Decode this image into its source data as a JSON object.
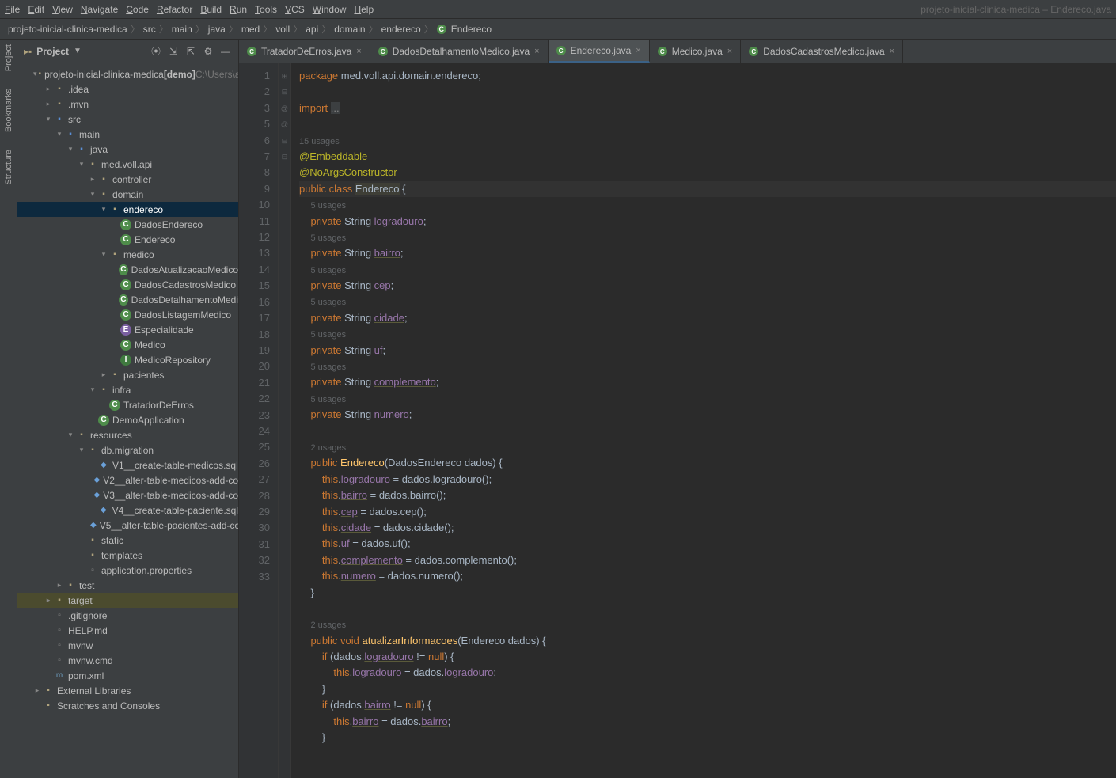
{
  "menu": {
    "items": [
      "File",
      "Edit",
      "View",
      "Navigate",
      "Code",
      "Refactor",
      "Build",
      "Run",
      "Tools",
      "VCS",
      "Window",
      "Help"
    ],
    "title": "projeto-inicial-clinica-medica – Endereco.java"
  },
  "breadcrumb": [
    "projeto-inicial-clinica-medica",
    "src",
    "main",
    "java",
    "med",
    "voll",
    "api",
    "domain",
    "endereco",
    "Endereco"
  ],
  "projectLabel": "Project",
  "tree": [
    {
      "d": 1,
      "a": "v",
      "i": "folder-open",
      "t": "projeto-inicial-clinica-medica",
      "suf": " [demo]",
      "dim": "  C:\\Users\\a"
    },
    {
      "d": 2,
      "a": ">",
      "i": "folder",
      "t": ".idea"
    },
    {
      "d": 2,
      "a": ">",
      "i": "folder",
      "t": ".mvn"
    },
    {
      "d": 2,
      "a": "v",
      "i": "src",
      "t": "src"
    },
    {
      "d": 3,
      "a": "v",
      "i": "src",
      "t": "main"
    },
    {
      "d": 4,
      "a": "v",
      "i": "src",
      "t": "java"
    },
    {
      "d": 5,
      "a": "v",
      "i": "folder",
      "t": "med.voll.api"
    },
    {
      "d": 6,
      "a": ">",
      "i": "folder",
      "t": "controller"
    },
    {
      "d": 6,
      "a": "v",
      "i": "folder",
      "t": "domain"
    },
    {
      "d": 7,
      "a": "v",
      "i": "folder",
      "t": "endereco",
      "sel": true
    },
    {
      "d": 8,
      "a": "",
      "i": "class",
      "t": "DadosEndereco"
    },
    {
      "d": 8,
      "a": "",
      "i": "class",
      "t": "Endereco"
    },
    {
      "d": 7,
      "a": "v",
      "i": "folder",
      "t": "medico"
    },
    {
      "d": 8,
      "a": "",
      "i": "class",
      "t": "DadosAtualizacaoMedico"
    },
    {
      "d": 8,
      "a": "",
      "i": "class",
      "t": "DadosCadastrosMedico"
    },
    {
      "d": 8,
      "a": "",
      "i": "class",
      "t": "DadosDetalhamentoMedi"
    },
    {
      "d": 8,
      "a": "",
      "i": "class",
      "t": "DadosListagemMedico"
    },
    {
      "d": 8,
      "a": "",
      "i": "enum",
      "t": "Especialidade"
    },
    {
      "d": 8,
      "a": "",
      "i": "class",
      "t": "Medico"
    },
    {
      "d": 8,
      "a": "",
      "i": "if",
      "t": "MedicoRepository"
    },
    {
      "d": 7,
      "a": ">",
      "i": "folder",
      "t": "pacientes"
    },
    {
      "d": 6,
      "a": "v",
      "i": "folder",
      "t": "infra"
    },
    {
      "d": 7,
      "a": "",
      "i": "class",
      "t": "TratadorDeErros"
    },
    {
      "d": 6,
      "a": "",
      "i": "class",
      "t": "DemoApplication"
    },
    {
      "d": 4,
      "a": "v",
      "i": "folder",
      "t": "resources"
    },
    {
      "d": 5,
      "a": "v",
      "i": "folder",
      "t": "db.migration"
    },
    {
      "d": 6,
      "a": "",
      "i": "sql",
      "t": "V1__create-table-medicos.sql"
    },
    {
      "d": 6,
      "a": "",
      "i": "sql",
      "t": "V2__alter-table-medicos-add-co"
    },
    {
      "d": 6,
      "a": "",
      "i": "sql",
      "t": "V3__alter-table-medicos-add-co"
    },
    {
      "d": 6,
      "a": "",
      "i": "sql",
      "t": "V4__create-table-paciente.sql"
    },
    {
      "d": 6,
      "a": "",
      "i": "sql",
      "t": "V5__alter-table-pacientes-add-co"
    },
    {
      "d": 5,
      "a": "",
      "i": "folder",
      "t": "static"
    },
    {
      "d": 5,
      "a": "",
      "i": "folder",
      "t": "templates"
    },
    {
      "d": 5,
      "a": "",
      "i": "file",
      "t": "application.properties"
    },
    {
      "d": 3,
      "a": ">",
      "i": "folder",
      "t": "test"
    },
    {
      "d": 2,
      "a": ">",
      "i": "folder",
      "t": "target",
      "hl": true
    },
    {
      "d": 2,
      "a": "",
      "i": "file",
      "t": ".gitignore"
    },
    {
      "d": 2,
      "a": "",
      "i": "file",
      "t": "HELP.md"
    },
    {
      "d": 2,
      "a": "",
      "i": "file",
      "t": "mvnw"
    },
    {
      "d": 2,
      "a": "",
      "i": "file",
      "t": "mvnw.cmd"
    },
    {
      "d": 2,
      "a": "",
      "i": "xml",
      "t": "pom.xml"
    },
    {
      "d": 1,
      "a": ">",
      "i": "folder",
      "t": "External Libraries"
    },
    {
      "d": 1,
      "a": "",
      "i": "folder",
      "t": "Scratches and Consoles"
    }
  ],
  "tabs": [
    {
      "t": "TratadorDeErros.java"
    },
    {
      "t": "DadosDetalhamentoMedico.java"
    },
    {
      "t": "Endereco.java",
      "active": true
    },
    {
      "t": "Medico.java"
    },
    {
      "t": "DadosCadastrosMedico.java"
    }
  ],
  "code": {
    "lines": [
      {
        "n": 1,
        "h": "<span class='kw'>package</span> med.voll.api.domain.endereco;"
      },
      {
        "n": 2,
        "h": ""
      },
      {
        "n": 3,
        "h": "<span class='kw'>import</span> <span style='background:#3c3f41;color:#888'>...</span>",
        "fold": "+"
      },
      {
        "n": 5,
        "h": ""
      },
      {
        "n": "",
        "h": "<span class='comment'>15 usages</span>"
      },
      {
        "n": 6,
        "h": "<span class='ann'>@Embeddable</span>",
        "fold": "-"
      },
      {
        "n": 7,
        "h": "<span class='ann'>@NoArgsConstructor</span>"
      },
      {
        "n": 8,
        "h": "<span class='kw'>public</span> <span class='kw'>class</span> <span class='cls-name'>Endereco</span> {",
        "cur": true
      },
      {
        "n": "",
        "h": "    <span class='comment'>5 usages</span>"
      },
      {
        "n": 9,
        "h": "    <span class='kw'>private</span> String <span class='fld'>logradouro</span>;"
      },
      {
        "n": "",
        "h": "    <span class='comment'>5 usages</span>"
      },
      {
        "n": 10,
        "h": "    <span class='kw'>private</span> String <span class='fld'>bairro</span>;"
      },
      {
        "n": "",
        "h": "    <span class='comment'>5 usages</span>"
      },
      {
        "n": 11,
        "h": "    <span class='kw'>private</span> String <span class='fld'>cep</span>;"
      },
      {
        "n": "",
        "h": "    <span class='comment'>5 usages</span>"
      },
      {
        "n": 12,
        "h": "    <span class='kw'>private</span> String <span class='fld'>cidade</span>;"
      },
      {
        "n": "",
        "h": "    <span class='comment'>5 usages</span>"
      },
      {
        "n": 13,
        "h": "    <span class='kw'>private</span> String <span class='fld'>uf</span>;"
      },
      {
        "n": "",
        "h": "    <span class='comment'>5 usages</span>"
      },
      {
        "n": 14,
        "h": "    <span class='kw'>private</span> String <span class='fld'>complemento</span>;"
      },
      {
        "n": "",
        "h": "    <span class='comment'>5 usages</span>"
      },
      {
        "n": 15,
        "h": "    <span class='kw'>private</span> String <span class='fld'>numero</span>;"
      },
      {
        "n": 16,
        "h": ""
      },
      {
        "n": "",
        "h": "    <span class='comment'>2 usages</span>"
      },
      {
        "n": 17,
        "h": "    <span class='kw'>public</span> <span class='mth'>Endereco</span>(DadosEndereco <span class='param'>dados</span>) {",
        "git": "@",
        "fold": "-"
      },
      {
        "n": 18,
        "h": "        <span class='kw'>this</span>.<span class='fld'>logradouro</span> = dados.logradouro();"
      },
      {
        "n": 19,
        "h": "        <span class='kw'>this</span>.<span class='fld'>bairro</span> = dados.bairro();"
      },
      {
        "n": 20,
        "h": "        <span class='kw'>this</span>.<span class='fld'>cep</span> = dados.cep();"
      },
      {
        "n": 21,
        "h": "        <span class='kw'>this</span>.<span class='fld'>cidade</span> = dados.cidade();"
      },
      {
        "n": 22,
        "h": "        <span class='kw'>this</span>.<span class='fld'>uf</span> = dados.uf();"
      },
      {
        "n": 23,
        "h": "        <span class='kw'>this</span>.<span class='fld'>complemento</span> = dados.complemento();"
      },
      {
        "n": 24,
        "h": "        <span class='kw'>this</span>.<span class='fld'>numero</span> = dados.numero();"
      },
      {
        "n": 25,
        "h": "    }"
      },
      {
        "n": 26,
        "h": ""
      },
      {
        "n": "",
        "h": "    <span class='comment'>2 usages</span>"
      },
      {
        "n": 27,
        "h": "    <span class='kw'>public</span> <span class='kw'>void</span> <span class='mth'>atualizarInformacoes</span>(Endereco <span class='param'>dados</span>) {",
        "git": "@",
        "fold": "-"
      },
      {
        "n": 28,
        "h": "        <span class='kw'>if</span> (dados.<span class='fld'>logradouro</span> != <span class='kw'>null</span>) {",
        "fold": "-"
      },
      {
        "n": 29,
        "h": "            <span class='kw'>this</span>.<span class='fld'>logradouro</span> = dados.<span class='fld'>logradouro</span>;"
      },
      {
        "n": 30,
        "h": "        }"
      },
      {
        "n": 31,
        "h": "        <span class='kw'>if</span> (dados.<span class='fld'>bairro</span> != <span class='kw'>null</span>) {",
        "fold": "-"
      },
      {
        "n": 32,
        "h": "            <span class='kw'>this</span>.<span class='fld'>bairro</span> = dados.<span class='fld'>bairro</span>;"
      },
      {
        "n": 33,
        "h": "        }"
      }
    ]
  },
  "sidetools": [
    "Project",
    "Bookmarks",
    "Structure"
  ]
}
